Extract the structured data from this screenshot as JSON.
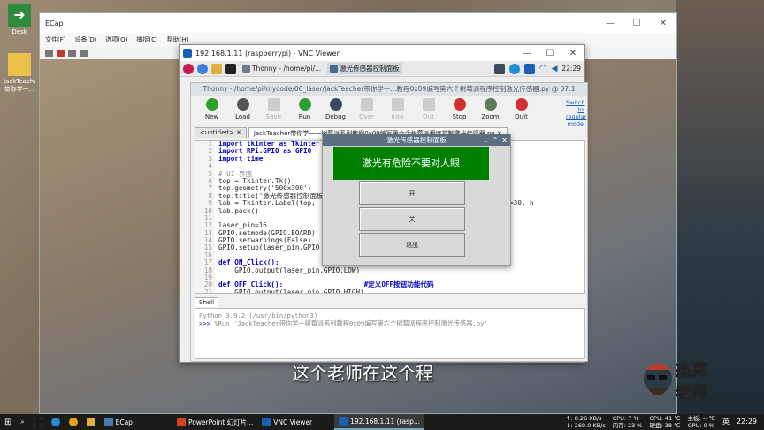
{
  "desktop": {
    "icons": [
      {
        "label": "Desk"
      },
      {
        "label": "JackTeacher带你学一..."
      }
    ]
  },
  "ecap": {
    "title": "ECap",
    "menu": [
      "文件(F)",
      "设备(D)",
      "选项(O)",
      "捕捉(C)",
      "帮助(H)"
    ],
    "controls": [
      "—",
      "☐",
      "✕"
    ]
  },
  "vnc": {
    "title": "192.168.1.11 (raspberrypi) - VNC Viewer",
    "controls": [
      "—",
      "☐",
      "✕"
    ],
    "panel": {
      "apps": [
        {
          "label": "Thonny - /home/pi/..."
        },
        {
          "label": "激光传感器控制面板"
        }
      ],
      "time": "22:29"
    }
  },
  "thonny": {
    "title": "Thonny - /home/pi/mycode/06_laser/JackTeacher带你学一...教程0x09编写第六个树莓派程序控制激光传感器.py @ 37:1",
    "toolbar": [
      {
        "label": "New",
        "enabled": true,
        "color": "#2e9e2e"
      },
      {
        "label": "Load",
        "enabled": true,
        "color": "#555555"
      },
      {
        "label": "Save",
        "enabled": false,
        "color": "#cccccc"
      },
      {
        "label": "Run",
        "enabled": true,
        "color": "#2e9e2e"
      },
      {
        "label": "Debug",
        "enabled": true,
        "color": "#3a4a5a"
      },
      {
        "label": "Over",
        "enabled": false,
        "color": "#cccccc"
      },
      {
        "label": "Into",
        "enabled": false,
        "color": "#cccccc"
      },
      {
        "label": "Out",
        "enabled": false,
        "color": "#cccccc"
      },
      {
        "label": "Stop",
        "enabled": true,
        "color": "#d32f2f"
      },
      {
        "label": "Zoom",
        "enabled": true,
        "color": "#5a7a5a"
      },
      {
        "label": "Quit",
        "enabled": true,
        "color": "#d32f2f"
      }
    ],
    "switch_mode": "Switch to regular mode",
    "tabs": [
      "<untitled> ✕",
      "JackTeacher带你学一一树莓派系列教程0x09编写第六个树莓派程序控制激光传感器.py ✕"
    ],
    "line_numbers": [
      "1",
      "2",
      "3",
      "4",
      "5",
      "6",
      "7",
      "8",
      "9",
      "10",
      "11",
      "12",
      "13",
      "14",
      "15",
      "16",
      "17",
      "18",
      "19",
      "20",
      "21"
    ],
    "code": [
      "import tkinter as Tkinter",
      "import RPi.GPIO as GPIO",
      "import time",
      "",
      "# UI 界面",
      "top = Tkinter.Tk()",
      "top.geometry('500x300')",
      "top.title('激光传感器控制面板')",
      "lab = Tkinter.Label(top,                                    , 18), width=30, h",
      "lab.pack()",
      "",
      "laser_pin=16",
      "GPIO.setmode(GPIO.BOARD)",
      "GPIO.setwarnings(False)",
      "GPIO.setup(laser_pin,GPIO",
      "",
      "def ON_Click():                     #定义ON按钮功能代码",
      "    GPIO.output(laser_pin,GPIO.LOW)",
      "",
      "def OFF_Click():                    #定义OFF按钮功能代码",
      "    GPIO.output(laser_pin,GPIO.HIGH)"
    ],
    "shell_tab": "Shell",
    "shell_lines": [
      "Python 3.9.2 (/usr/bin/python3)",
      "%Run 'JackTeacher带你学一树莓派系列教程0x09编写第六个树莓派程序控制激光传感器.py'"
    ],
    "shell_prompt": ">>>"
  },
  "laser_window": {
    "title": "激光传感器控制面板",
    "controls": [
      "⌄",
      "⌃",
      "✕"
    ],
    "label": "激光有危险不要对人眼",
    "label_color": "#008000",
    "buttons": [
      "开",
      "关",
      "退出"
    ]
  },
  "subtitle": "这个老师在这个程",
  "logo": {
    "text": "杰克老师"
  },
  "taskbar": {
    "items": [
      {
        "label": "ECap",
        "active": false
      },
      {
        "label": "PowerPoint 幻灯片...",
        "active": false
      },
      {
        "label": "VNC Viewer",
        "active": false
      },
      {
        "label": "192.168.1.11 (rasp...",
        "active": true
      }
    ],
    "net_up": "↑: 8.26 KB/s",
    "net_down": "↓: 269.0 KB/s",
    "cpu": "CPU: 7 %",
    "cpu_temp": "CPU: 41 ℃",
    "mem": "内存: 23 %",
    "disk_temp": "主板: -- ℃",
    "disk": "硬盘: 38 ℃",
    "gpu": "GPU: 0 %",
    "ime": "英",
    "time": "22:29"
  }
}
